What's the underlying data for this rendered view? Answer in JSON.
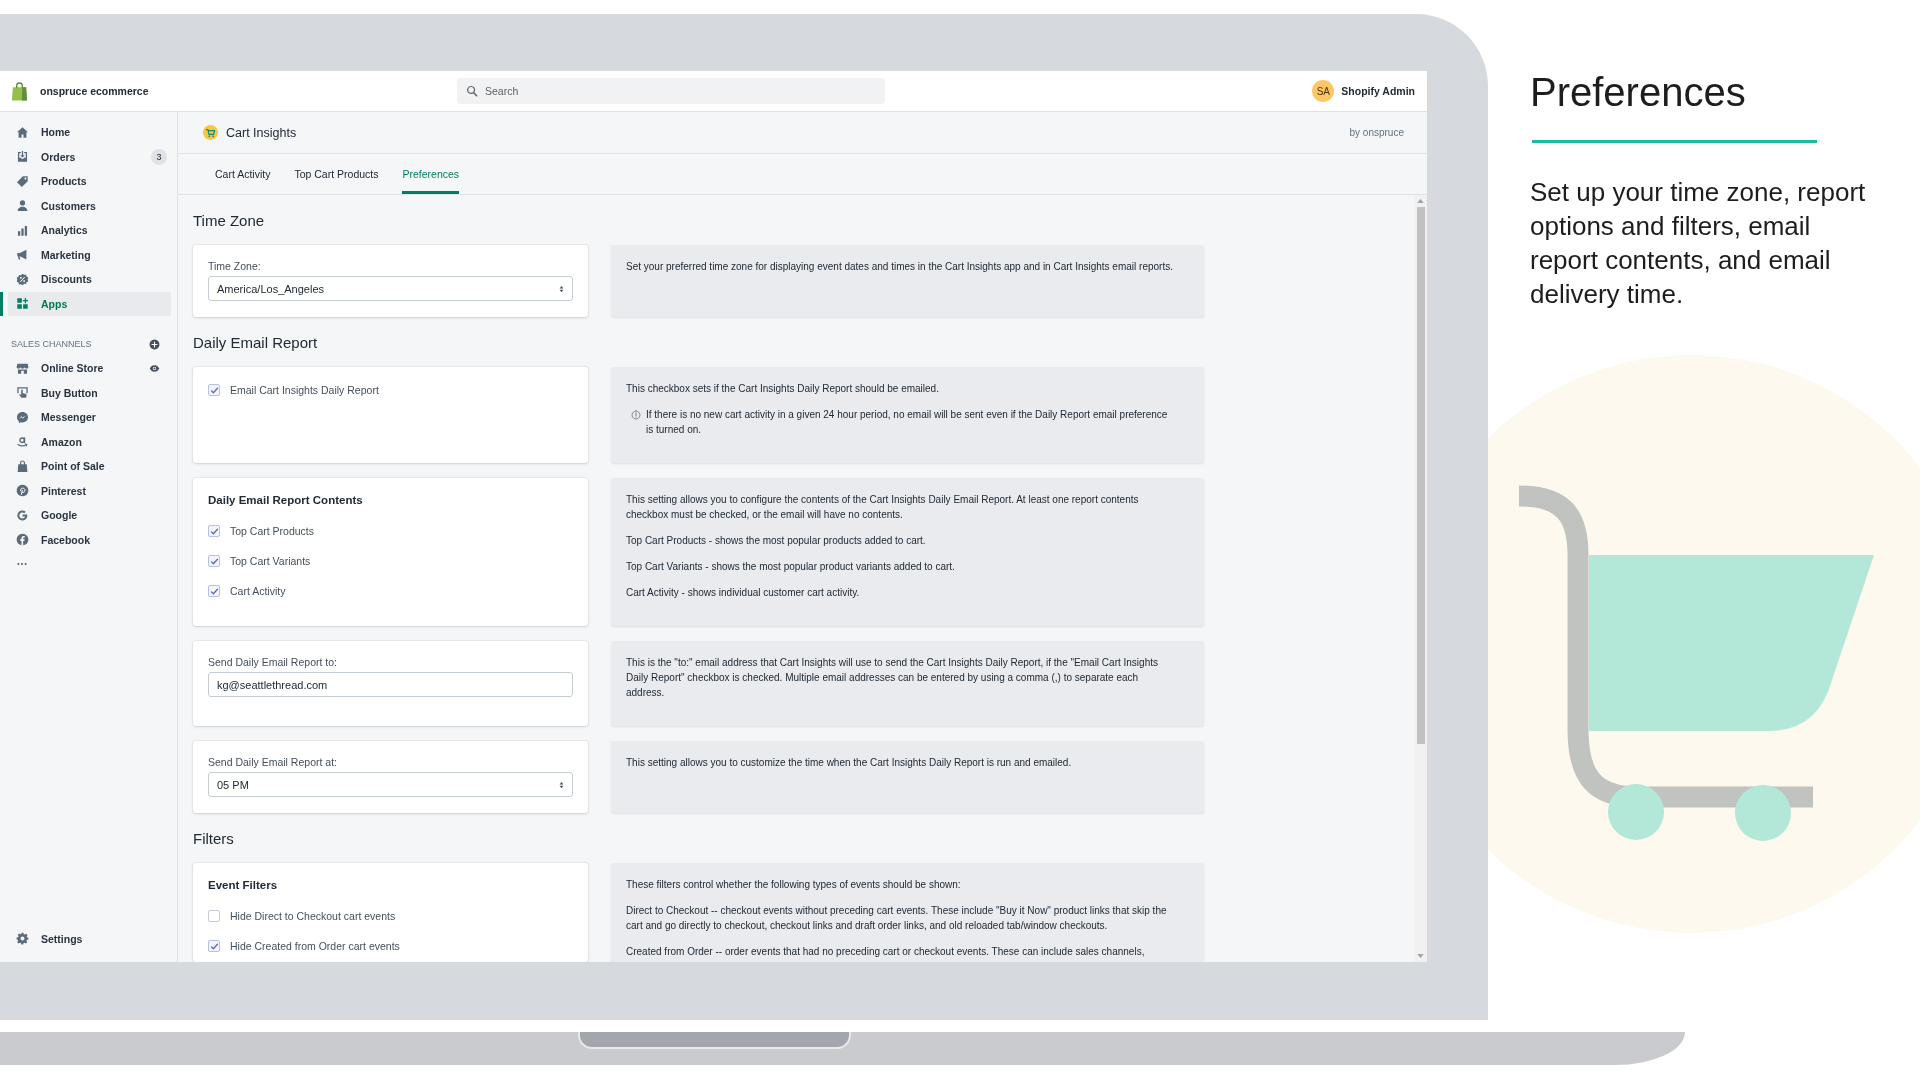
{
  "topbar": {
    "store_name": "onspruce ecommerce",
    "search": {
      "placeholder": "Search"
    },
    "user": {
      "initials": "SA",
      "name": "Shopify Admin"
    }
  },
  "sidebar": {
    "items": [
      {
        "label": "Home",
        "selected": false
      },
      {
        "label": "Orders",
        "selected": false,
        "badge": "3"
      },
      {
        "label": "Products",
        "selected": false
      },
      {
        "label": "Customers",
        "selected": false
      },
      {
        "label": "Analytics",
        "selected": false
      },
      {
        "label": "Marketing",
        "selected": false
      },
      {
        "label": "Discounts",
        "selected": false
      },
      {
        "label": "Apps",
        "selected": true
      }
    ],
    "sales_channels": {
      "title": "SALES CHANNELS",
      "items": [
        {
          "label": "Online Store",
          "selected": false
        },
        {
          "label": "Buy Button",
          "selected": false
        },
        {
          "label": "Messenger",
          "selected": false
        },
        {
          "label": "Amazon",
          "selected": false
        },
        {
          "label": "Point of Sale",
          "selected": false
        },
        {
          "label": "Pinterest",
          "selected": false
        },
        {
          "label": "Google",
          "selected": false
        },
        {
          "label": "Facebook",
          "selected": false
        }
      ]
    },
    "settings": {
      "label": "Settings"
    }
  },
  "app": {
    "title": "Cart Insights",
    "byline": "by onspruce",
    "tabs": [
      {
        "label": "Cart Activity",
        "selected": false
      },
      {
        "label": "Top Cart Products",
        "selected": false
      },
      {
        "label": "Preferences",
        "selected": true
      }
    ]
  },
  "sections": [
    {
      "heading": "Time Zone",
      "rows": [
        {
          "control": {
            "kind": "select",
            "label": "Time Zone:",
            "value": "America/Los_Angeles"
          },
          "description": [
            {
              "kind": "text",
              "text": "Set your preferred time zone for displaying event dates and times in the Cart Insights app and in Cart Insights email reports."
            }
          ]
        }
      ]
    },
    {
      "heading": "Daily Email Report",
      "rows": [
        {
          "control": {
            "kind": "checklist",
            "options": [
              {
                "label": "Email Cart Insights Daily Report",
                "checked": true
              }
            ]
          },
          "description": [
            {
              "kind": "text",
              "text": "This checkbox sets if the Cart Insights Daily Report should be emailed."
            },
            {
              "kind": "note",
              "text": "If there is no new cart activity in a given 24 hour period, no email will be sent even if the Daily Report email preference is turned on."
            }
          ]
        },
        {
          "control": {
            "kind": "checklist",
            "title": "Daily Email Report Contents",
            "options": [
              {
                "label": "Top Cart Products",
                "checked": true
              },
              {
                "label": "Top Cart Variants",
                "checked": true
              },
              {
                "label": "Cart Activity",
                "checked": true
              }
            ]
          },
          "description": [
            {
              "kind": "text",
              "text": "This setting allows you to configure the contents of the Cart Insights Daily Email Report. At least one report contents checkbox must be checked, or the email will have no contents."
            },
            {
              "kind": "text",
              "text": "Top Cart Products - shows the most popular products added to cart."
            },
            {
              "kind": "text",
              "text": "Top Cart Variants - shows the most popular product variants added to cart."
            },
            {
              "kind": "text",
              "text": "Cart Activity - shows individual customer cart activity."
            }
          ]
        },
        {
          "control": {
            "kind": "input",
            "label": "Send Daily Email Report to:",
            "value": "kg@seattlethread.com"
          },
          "description": [
            {
              "kind": "text",
              "text": "This is the \"to:\" email address that Cart Insights will use to send the Cart Insights Daily Report, if the \"Email Cart Insights Daily Report\" checkbox is checked. Multiple email addresses can be entered by using a comma (,) to separate each address."
            }
          ]
        },
        {
          "control": {
            "kind": "select",
            "label": "Send Daily Email Report at:",
            "value": "05 PM"
          },
          "description": [
            {
              "kind": "text",
              "text": "This setting allows you to customize the time when the Cart Insights Daily Report is run and emailed."
            }
          ]
        }
      ]
    },
    {
      "heading": "Filters",
      "rows": [
        {
          "control": {
            "kind": "checklist",
            "title": "Event Filters",
            "options": [
              {
                "label": "Hide Direct to Checkout cart events",
                "checked": false
              },
              {
                "label": "Hide Created from Order cart events",
                "checked": true
              }
            ]
          },
          "description": [
            {
              "kind": "text",
              "text": "These filters control whether the following types of events should be shown:"
            },
            {
              "kind": "text",
              "text": "Direct to Checkout -- checkout events without preceding cart events. These include \"Buy it Now\" product links that skip the cart and go directly to checkout, checkout links and draft order links, and old reloaded tab/window checkouts."
            },
            {
              "kind": "text",
              "text": "Created from Order -- order events that had no preceding cart or checkout events. These can include sales channels,"
            }
          ]
        }
      ]
    }
  ],
  "promo": {
    "title": "Preferences",
    "text": "Set up your time zone, report options and filters, email report contents, and email delivery time."
  }
}
